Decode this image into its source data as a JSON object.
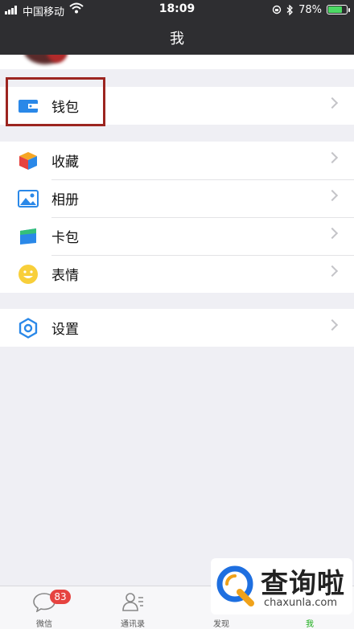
{
  "status_bar": {
    "carrier": "中国移动",
    "time": "18:09",
    "battery": "78%",
    "battery_level": 0.78
  },
  "nav": {
    "title": "我"
  },
  "menu": {
    "wallet": {
      "label": "钱包",
      "icon": "wallet-icon",
      "color": "#2a88e8"
    },
    "items": [
      {
        "label": "收藏",
        "icon": "favorites-cube-icon"
      },
      {
        "label": "相册",
        "icon": "album-icon"
      },
      {
        "label": "卡包",
        "icon": "card-pack-icon"
      },
      {
        "label": "表情",
        "icon": "sticker-smile-icon"
      }
    ],
    "settings": {
      "label": "设置",
      "icon": "settings-gear-icon"
    }
  },
  "tabbar": {
    "tabs": [
      {
        "label": "微信",
        "icon": "chat-bubble-icon",
        "badge": "83"
      },
      {
        "label": "通讯录",
        "icon": "contacts-icon"
      },
      {
        "label": "发现",
        "icon": "discover-icon"
      },
      {
        "label": "我",
        "icon": "me-icon",
        "active": true
      }
    ],
    "active_color": "#1aad19"
  },
  "watermark": {
    "text": "查询啦",
    "url": "chaxunla.com"
  }
}
